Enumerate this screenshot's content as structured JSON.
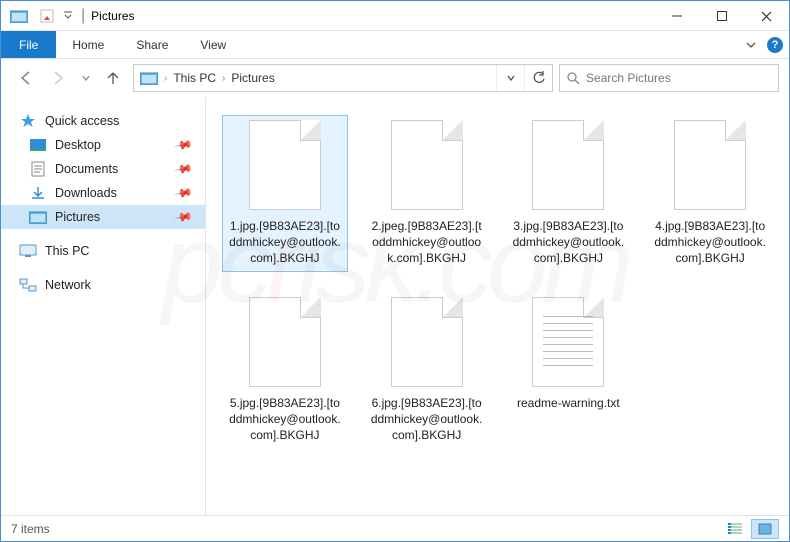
{
  "titlebar": {
    "title_text": "Pictures",
    "separator": "|"
  },
  "ribbon": {
    "file_label": "File",
    "tabs": [
      "Home",
      "Share",
      "View"
    ]
  },
  "breadcrumbs": {
    "items": [
      "This PC",
      "Pictures"
    ]
  },
  "search": {
    "placeholder": "Search Pictures"
  },
  "sidebar": {
    "quick_access": {
      "label": "Quick access",
      "items": [
        {
          "label": "Desktop",
          "pinned": true,
          "icon": "desktop"
        },
        {
          "label": "Documents",
          "pinned": true,
          "icon": "documents"
        },
        {
          "label": "Downloads",
          "pinned": true,
          "icon": "downloads"
        },
        {
          "label": "Pictures",
          "pinned": true,
          "icon": "pictures",
          "selected": true
        }
      ]
    },
    "this_pc": {
      "label": "This PC"
    },
    "network": {
      "label": "Network"
    }
  },
  "files": [
    {
      "name": "1.jpg.[9B83AE23].[toddmhickey@outlook.com].BKGHJ",
      "selected": true,
      "type": "blank"
    },
    {
      "name": "2.jpeg.[9B83AE23].[toddmhickey@outlook.com].BKGHJ",
      "selected": false,
      "type": "blank"
    },
    {
      "name": "3.jpg.[9B83AE23].[toddmhickey@outlook.com].BKGHJ",
      "selected": false,
      "type": "blank"
    },
    {
      "name": "4.jpg.[9B83AE23].[toddmhickey@outlook.com].BKGHJ",
      "selected": false,
      "type": "blank"
    },
    {
      "name": "5.jpg.[9B83AE23].[toddmhickey@outlook.com].BKGHJ",
      "selected": false,
      "type": "blank"
    },
    {
      "name": "6.jpg.[9B83AE23].[toddmhickey@outlook.com].BKGHJ",
      "selected": false,
      "type": "blank"
    },
    {
      "name": "readme-warning.txt",
      "selected": false,
      "type": "text"
    }
  ],
  "status": {
    "count_label": "7 items"
  },
  "watermark": {
    "before_r": "pc",
    "r": "r",
    "after_r": "isk.com"
  }
}
